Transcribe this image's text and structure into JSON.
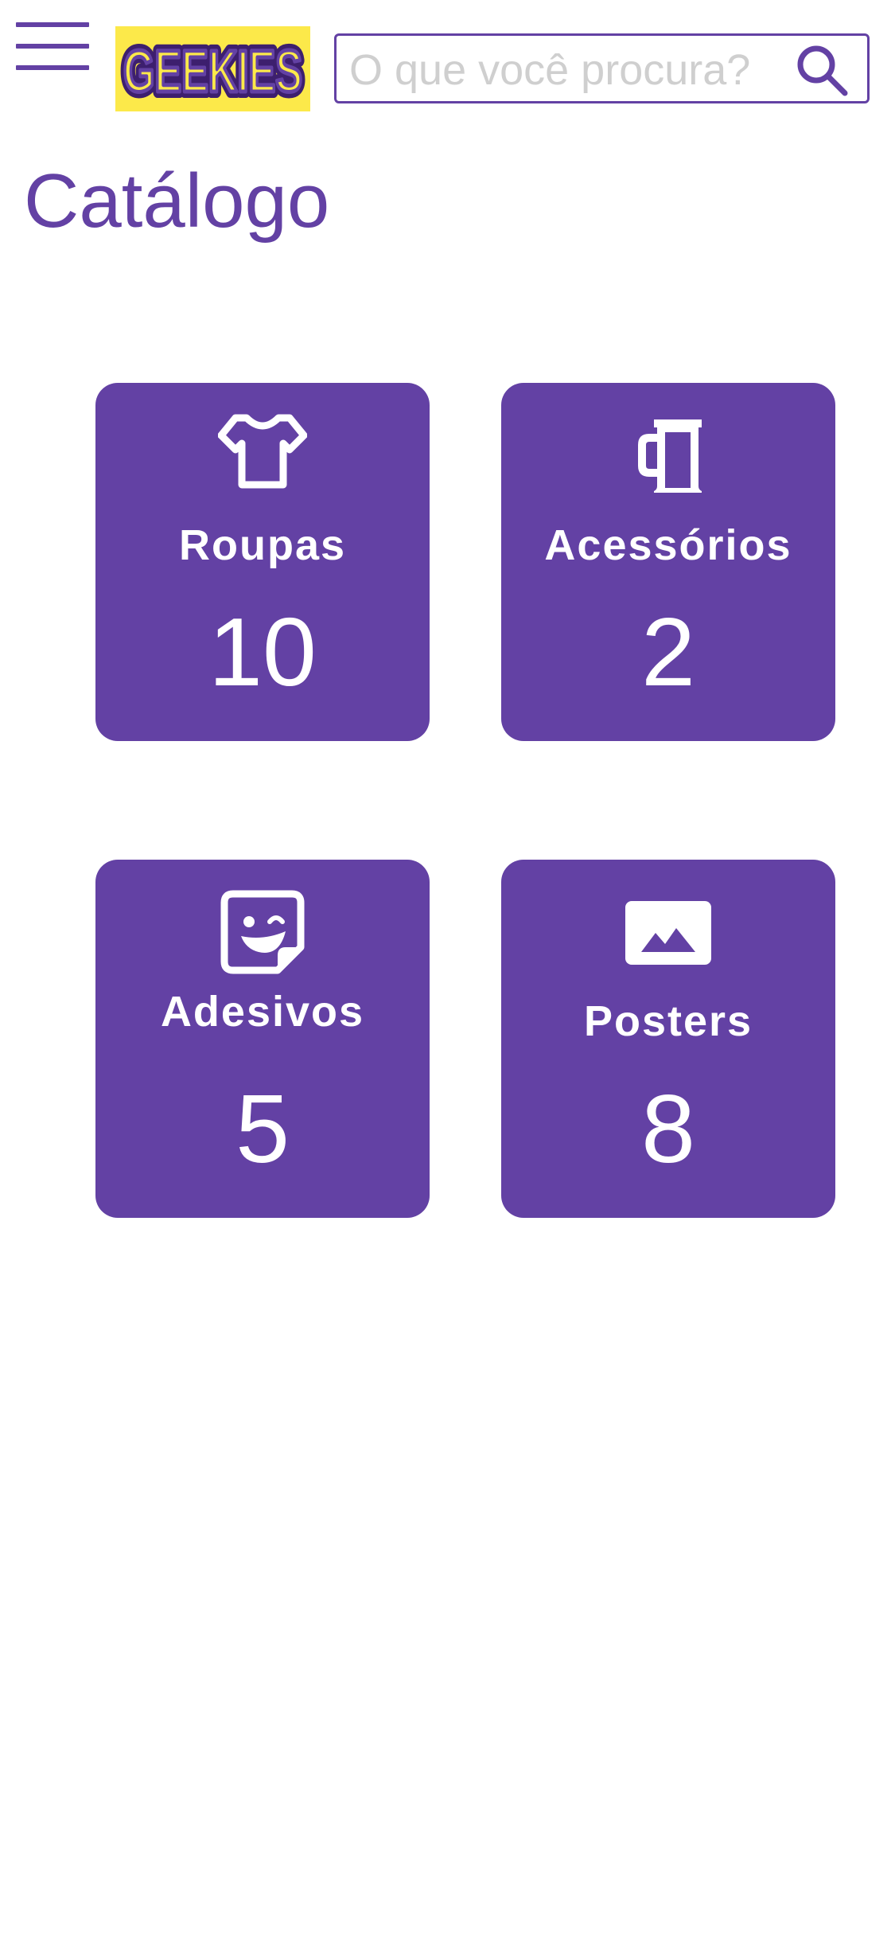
{
  "header": {
    "menu_icon": "hamburger-menu-icon",
    "logo_text": "GEEKIES",
    "search": {
      "placeholder": "O que você procura?",
      "value": "",
      "icon": "search-icon"
    }
  },
  "page": {
    "title": "Catálogo"
  },
  "catalog": {
    "categories": [
      {
        "label": "Roupas",
        "count": "10",
        "icon": "tshirt-icon"
      },
      {
        "label": "Acessórios",
        "count": "2",
        "icon": "mug-icon"
      },
      {
        "label": "Adesivos",
        "count": "5",
        "icon": "sticker-icon"
      },
      {
        "label": "Posters",
        "count": "8",
        "icon": "image-icon"
      }
    ]
  },
  "colors": {
    "primary": "#6341a4",
    "logo_background": "#fce94a",
    "card_text": "#ffffff",
    "placeholder": "#cfcfcf"
  }
}
